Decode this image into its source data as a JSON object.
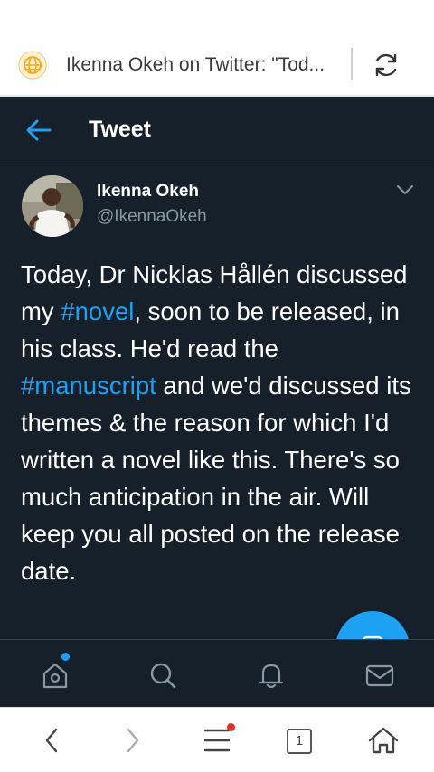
{
  "browser": {
    "page_title": "Ikenna Okeh on Twitter: \"Tod...",
    "tab_count": "1"
  },
  "header": {
    "title": "Tweet"
  },
  "tweet": {
    "author_name": "Ikenna Okeh",
    "author_handle": "@IkennaOkeh",
    "text_parts": {
      "p1": "Today, Dr Nicklas Hållén discussed my ",
      "tag1": "#novel",
      "p2": ", soon to be released, in his class. He'd read the ",
      "tag2": "#manuscript",
      "p3": " and we'd discussed its themes & the reason for which I'd written a novel like this. There's so much anticipation in the air. Will keep you all posted on the release date."
    }
  },
  "tab_bar": {
    "items": [
      "home-icon",
      "search-icon",
      "notifications-icon",
      "messages-icon"
    ]
  },
  "colors": {
    "background": "#15202b",
    "accent": "#1da1f2",
    "text": "#ffffff",
    "secondary_text": "#8899a6"
  }
}
